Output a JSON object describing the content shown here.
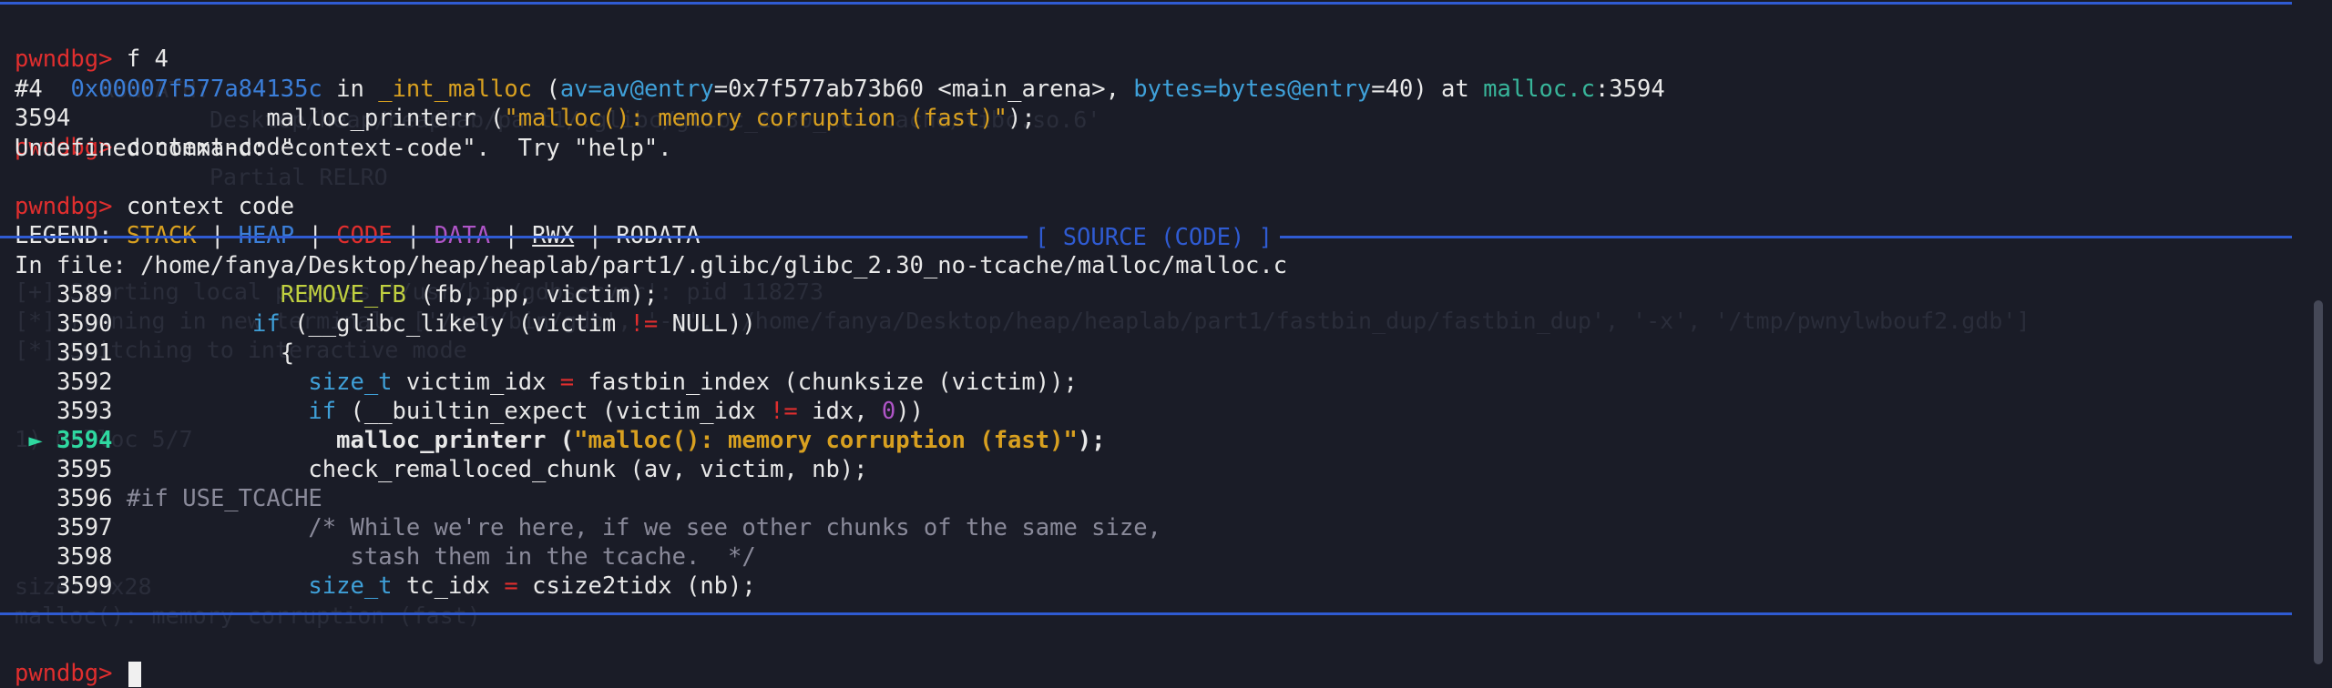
{
  "prompt": "pwndbg>",
  "cmd1": "f 4",
  "frame": {
    "num": "#4",
    "addr": "0x00007f577a84135c",
    "in": "in",
    "func": "_int_malloc",
    "arg1_name": "av=av@entry",
    "arg1_val": "=0x7f577ab73b60 <main_arena>,",
    "arg2_name": "bytes=bytes@entry",
    "arg2_val": "=40) at",
    "file": "malloc.c",
    "line": ":3594"
  },
  "frame_src": {
    "lineno": "3594",
    "code_pre": "              malloc_printerr (",
    "code_str": "\"malloc(): memory corruption (fast)\"",
    "code_post": ");"
  },
  "cmd2": "context-code",
  "error_msg": "Undefined command: \"context-code\".  Try \"help\".",
  "cmd3": "context code",
  "legend": {
    "label": "LEGEND:",
    "stack": "STACK",
    "heap": "HEAP",
    "code": "CODE",
    "data": "DATA",
    "rwx": "RWX",
    "rodata": "RODATA",
    "sep": "|"
  },
  "section_title": "[ SOURCE (CODE) ]",
  "in_file": "In file: /home/fanya/Desktop/heap/heaplab/part1/.glibc/glibc_2.30_no-tcache/malloc/malloc.c",
  "source": {
    "l3589_no": "3589",
    "l3589_macro": "REMOVE_FB",
    "l3589_rest": " (fb, pp, victim);",
    "l3590_no": "3590",
    "l3590_kw": "if",
    "l3590_a": " (__glibc_likely (victim ",
    "l3590_op": "!=",
    "l3590_b": " NULL))",
    "l3591_no": "3591",
    "l3591_code": "{",
    "l3592_no": "3592",
    "l3592_type": "size_t",
    "l3592_a": " victim_idx ",
    "l3592_op": "=",
    "l3592_b": " fastbin_index (chunksize (victim));",
    "l3593_no": "3593",
    "l3593_kw": "if",
    "l3593_a": " (__builtin_expect (victim_idx ",
    "l3593_op": "!=",
    "l3593_b": " idx, ",
    "l3593_num": "0",
    "l3593_c": "))",
    "l3594_arrow": "►",
    "l3594_no": "3594",
    "l3594_a": "malloc_printerr (",
    "l3594_str": "\"malloc(): memory corruption (fast)\"",
    "l3594_b": ");",
    "l3595_no": "3595",
    "l3595_code": "check_remalloced_chunk (av, victim, nb);",
    "l3596_no": "3596",
    "l3596_code": "#if USE_TCACHE",
    "l3597_no": "3597",
    "l3597_code": "/* While we're here, if we see other chunks of the same size,",
    "l3598_no": "3598",
    "l3598_code": "stash them in the tcache.  */",
    "l3599_no": "3599",
    "l3599_type": "size_t",
    "l3599_a": " tc_idx ",
    "l3599_op": "=",
    "l3599_b": " csize2tidx (nb);"
  },
  "ghost": {
    "g1": "RUNPATH:",
    "g2": "Desktop/heap/heaplab/part1/.glibc/glibc_2.30_no-tcache/libc.so.6'",
    "g3": "Partial RELRO",
    "g4": "[+] Starting local process '/usr/bin/gdbserver': pid 118273",
    "g5": "[*] running in new terminal: ['/usr/bin/gdb', '-q', '/home/fanya/Desktop/heap/heaplab/part1/fastbin_dup/fastbin_dup', '-x', '/tmp/pwnylwbouf2.gdb']",
    "g6": "[*] Switching to interactive mode",
    "g7": "1) malloc 5/7",
    "g8": "size: 0x28",
    "g9": "malloc(): memory corruption (fast)"
  }
}
